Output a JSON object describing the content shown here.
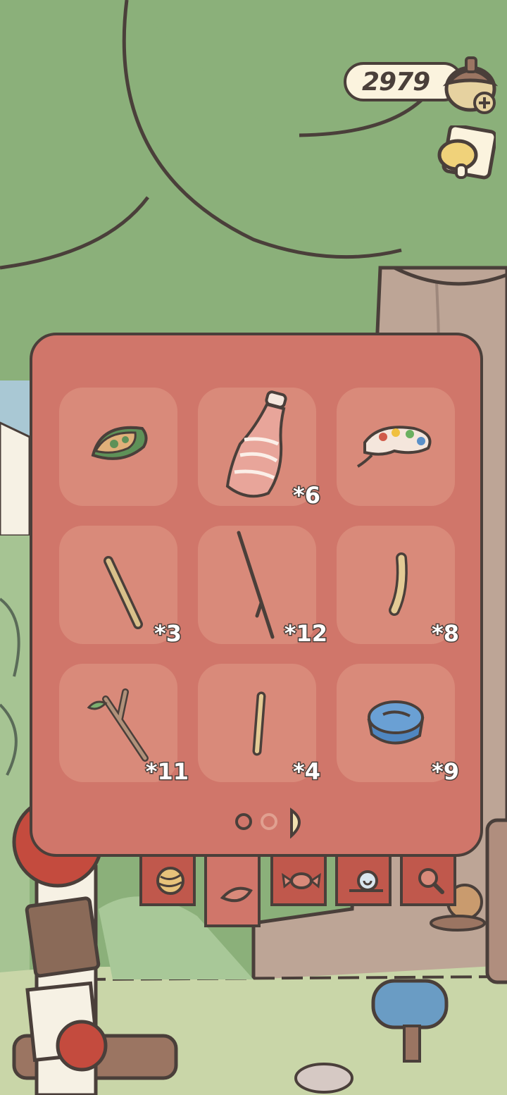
{
  "hud": {
    "acorn_count": "2979",
    "acorn_icon": "acorn-icon",
    "add_icon": "plus-icon",
    "notice_icon": "bell-note-icon"
  },
  "bag": {
    "items": [
      {
        "icon": "dumpling-icon",
        "count": ""
      },
      {
        "icon": "plastic-bottle-icon",
        "count": "*6"
      },
      {
        "icon": "paint-palette-icon",
        "count": ""
      },
      {
        "icon": "stick-icon",
        "count": "*3"
      },
      {
        "icon": "long-twig-icon",
        "count": "*12"
      },
      {
        "icon": "chopstick-icon",
        "count": "*8"
      },
      {
        "icon": "branch-icon",
        "count": "*11"
      },
      {
        "icon": "rod-icon",
        "count": "*4"
      },
      {
        "icon": "bottle-cap-icon",
        "count": "*9"
      }
    ],
    "pages": 3,
    "current_page": 3
  },
  "tabs": [
    {
      "icon": "yarn-ball-icon",
      "active": false
    },
    {
      "icon": "leaf-icon",
      "active": true
    },
    {
      "icon": "candy-icon",
      "active": false
    },
    {
      "icon": "snail-icon",
      "active": false
    },
    {
      "icon": "search-icon",
      "active": false
    }
  ],
  "colors": {
    "panel": "#d0766a",
    "slot": "#d98a7a",
    "tab": "#c0584c",
    "outline": "#4a3f3a",
    "foliage": "#8bb07a"
  }
}
